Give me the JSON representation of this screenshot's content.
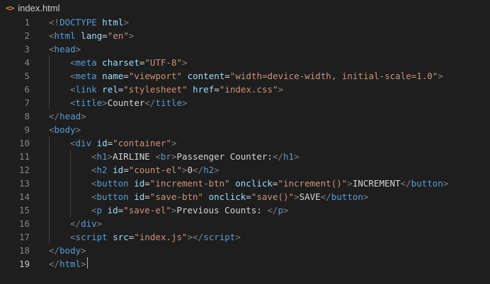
{
  "tab": {
    "icon": "<>",
    "filename": "index.html"
  },
  "colors": {
    "tag_bracket": "#808080",
    "tag_name": "#569cd6",
    "attr_name": "#9cdcfe",
    "attr_value": "#ce9178",
    "text": "#d4d4d4",
    "line_number": "#858585"
  },
  "lines": [
    {
      "n": "1",
      "indent": 0,
      "segs": [
        [
          "<!",
          "b"
        ],
        [
          "DOCTYPE",
          "t"
        ],
        [
          " ",
          "x"
        ],
        [
          "html",
          "a"
        ],
        [
          ">",
          "b"
        ]
      ]
    },
    {
      "n": "2",
      "indent": 0,
      "segs": [
        [
          "<",
          "b"
        ],
        [
          "html",
          "t"
        ],
        [
          " ",
          "x"
        ],
        [
          "lang",
          "a"
        ],
        [
          "=",
          "x"
        ],
        [
          "\"en\"",
          "v"
        ],
        [
          ">",
          "b"
        ]
      ]
    },
    {
      "n": "3",
      "indent": 0,
      "segs": [
        [
          "<",
          "b"
        ],
        [
          "head",
          "t"
        ],
        [
          ">",
          "b"
        ]
      ]
    },
    {
      "n": "4",
      "indent": 1,
      "segs": [
        [
          "<",
          "b"
        ],
        [
          "meta",
          "t"
        ],
        [
          " ",
          "x"
        ],
        [
          "charset",
          "a"
        ],
        [
          "=",
          "x"
        ],
        [
          "\"UTF-8\"",
          "v"
        ],
        [
          ">",
          "b"
        ]
      ]
    },
    {
      "n": "5",
      "indent": 1,
      "segs": [
        [
          "<",
          "b"
        ],
        [
          "meta",
          "t"
        ],
        [
          " ",
          "x"
        ],
        [
          "name",
          "a"
        ],
        [
          "=",
          "x"
        ],
        [
          "\"viewport\"",
          "v"
        ],
        [
          " ",
          "x"
        ],
        [
          "content",
          "a"
        ],
        [
          "=",
          "x"
        ],
        [
          "\"width=device-width, initial-scale=1.0\"",
          "v"
        ],
        [
          ">",
          "b"
        ]
      ]
    },
    {
      "n": "6",
      "indent": 1,
      "segs": [
        [
          "<",
          "b"
        ],
        [
          "link",
          "t"
        ],
        [
          " ",
          "x"
        ],
        [
          "rel",
          "a"
        ],
        [
          "=",
          "x"
        ],
        [
          "\"stylesheet\"",
          "v"
        ],
        [
          " ",
          "x"
        ],
        [
          "href",
          "a"
        ],
        [
          "=",
          "x"
        ],
        [
          "\"index.css\"",
          "v"
        ],
        [
          ">",
          "b"
        ]
      ]
    },
    {
      "n": "7",
      "indent": 1,
      "segs": [
        [
          "<",
          "b"
        ],
        [
          "title",
          "t"
        ],
        [
          ">",
          "b"
        ],
        [
          "Counter",
          "x"
        ],
        [
          "</",
          "b"
        ],
        [
          "title",
          "t"
        ],
        [
          ">",
          "b"
        ]
      ]
    },
    {
      "n": "8",
      "indent": 0,
      "segs": [
        [
          "</",
          "b"
        ],
        [
          "head",
          "t"
        ],
        [
          ">",
          "b"
        ]
      ]
    },
    {
      "n": "9",
      "indent": 0,
      "segs": [
        [
          "<",
          "b"
        ],
        [
          "body",
          "t"
        ],
        [
          ">",
          "b"
        ]
      ]
    },
    {
      "n": "10",
      "indent": 1,
      "segs": [
        [
          "<",
          "b"
        ],
        [
          "div",
          "t"
        ],
        [
          " ",
          "x"
        ],
        [
          "id",
          "a"
        ],
        [
          "=",
          "x"
        ],
        [
          "\"container\"",
          "v"
        ],
        [
          ">",
          "b"
        ]
      ]
    },
    {
      "n": "11",
      "indent": 2,
      "segs": [
        [
          "<",
          "b"
        ],
        [
          "h1",
          "t"
        ],
        [
          ">",
          "b"
        ],
        [
          "AIRLINE ",
          "x"
        ],
        [
          "<",
          "b"
        ],
        [
          "br",
          "t"
        ],
        [
          ">",
          "b"
        ],
        [
          "Passenger Counter:",
          "x"
        ],
        [
          "</",
          "b"
        ],
        [
          "h1",
          "t"
        ],
        [
          ">",
          "b"
        ]
      ]
    },
    {
      "n": "12",
      "indent": 2,
      "segs": [
        [
          "<",
          "b"
        ],
        [
          "h2",
          "t"
        ],
        [
          " ",
          "x"
        ],
        [
          "id",
          "a"
        ],
        [
          "=",
          "x"
        ],
        [
          "\"count-el\"",
          "v"
        ],
        [
          ">",
          "b"
        ],
        [
          "0",
          "x"
        ],
        [
          "</",
          "b"
        ],
        [
          "h2",
          "t"
        ],
        [
          ">",
          "b"
        ]
      ]
    },
    {
      "n": "13",
      "indent": 2,
      "segs": [
        [
          "<",
          "b"
        ],
        [
          "button",
          "t"
        ],
        [
          " ",
          "x"
        ],
        [
          "id",
          "a"
        ],
        [
          "=",
          "x"
        ],
        [
          "\"increment-btn\"",
          "v"
        ],
        [
          " ",
          "x"
        ],
        [
          "onclick",
          "a"
        ],
        [
          "=",
          "x"
        ],
        [
          "\"increment()\"",
          "v"
        ],
        [
          ">",
          "b"
        ],
        [
          "INCREMENT",
          "x"
        ],
        [
          "</",
          "b"
        ],
        [
          "button",
          "t"
        ],
        [
          ">",
          "b"
        ]
      ]
    },
    {
      "n": "14",
      "indent": 2,
      "segs": [
        [
          "<",
          "b"
        ],
        [
          "button",
          "t"
        ],
        [
          " ",
          "x"
        ],
        [
          "id",
          "a"
        ],
        [
          "=",
          "x"
        ],
        [
          "\"save-btn\"",
          "v"
        ],
        [
          " ",
          "x"
        ],
        [
          "onclick",
          "a"
        ],
        [
          "=",
          "x"
        ],
        [
          "\"save()\"",
          "v"
        ],
        [
          ">",
          "b"
        ],
        [
          "SAVE",
          "x"
        ],
        [
          "</",
          "b"
        ],
        [
          "button",
          "t"
        ],
        [
          ">",
          "b"
        ]
      ]
    },
    {
      "n": "15",
      "indent": 2,
      "segs": [
        [
          "<",
          "b"
        ],
        [
          "p",
          "t"
        ],
        [
          " ",
          "x"
        ],
        [
          "id",
          "a"
        ],
        [
          "=",
          "x"
        ],
        [
          "\"save-el\"",
          "v"
        ],
        [
          ">",
          "b"
        ],
        [
          "Previous Counts: ",
          "x"
        ],
        [
          "</",
          "b"
        ],
        [
          "p",
          "t"
        ],
        [
          ">",
          "b"
        ]
      ]
    },
    {
      "n": "16",
      "indent": 1,
      "segs": [
        [
          "</",
          "b"
        ],
        [
          "div",
          "t"
        ],
        [
          ">",
          "b"
        ]
      ]
    },
    {
      "n": "17",
      "indent": 1,
      "segs": [
        [
          "<",
          "b"
        ],
        [
          "script",
          "t"
        ],
        [
          " ",
          "x"
        ],
        [
          "src",
          "a"
        ],
        [
          "=",
          "x"
        ],
        [
          "\"index.js\"",
          "v"
        ],
        [
          "></",
          "b"
        ],
        [
          "script",
          "t"
        ],
        [
          ">",
          "b"
        ]
      ]
    },
    {
      "n": "18",
      "indent": 0,
      "segs": [
        [
          "</",
          "b"
        ],
        [
          "body",
          "t"
        ],
        [
          ">",
          "b"
        ]
      ]
    },
    {
      "n": "19",
      "indent": 0,
      "segs": [
        [
          "</",
          "b"
        ],
        [
          "html",
          "t"
        ],
        [
          ">",
          "b"
        ]
      ],
      "current": true
    }
  ]
}
